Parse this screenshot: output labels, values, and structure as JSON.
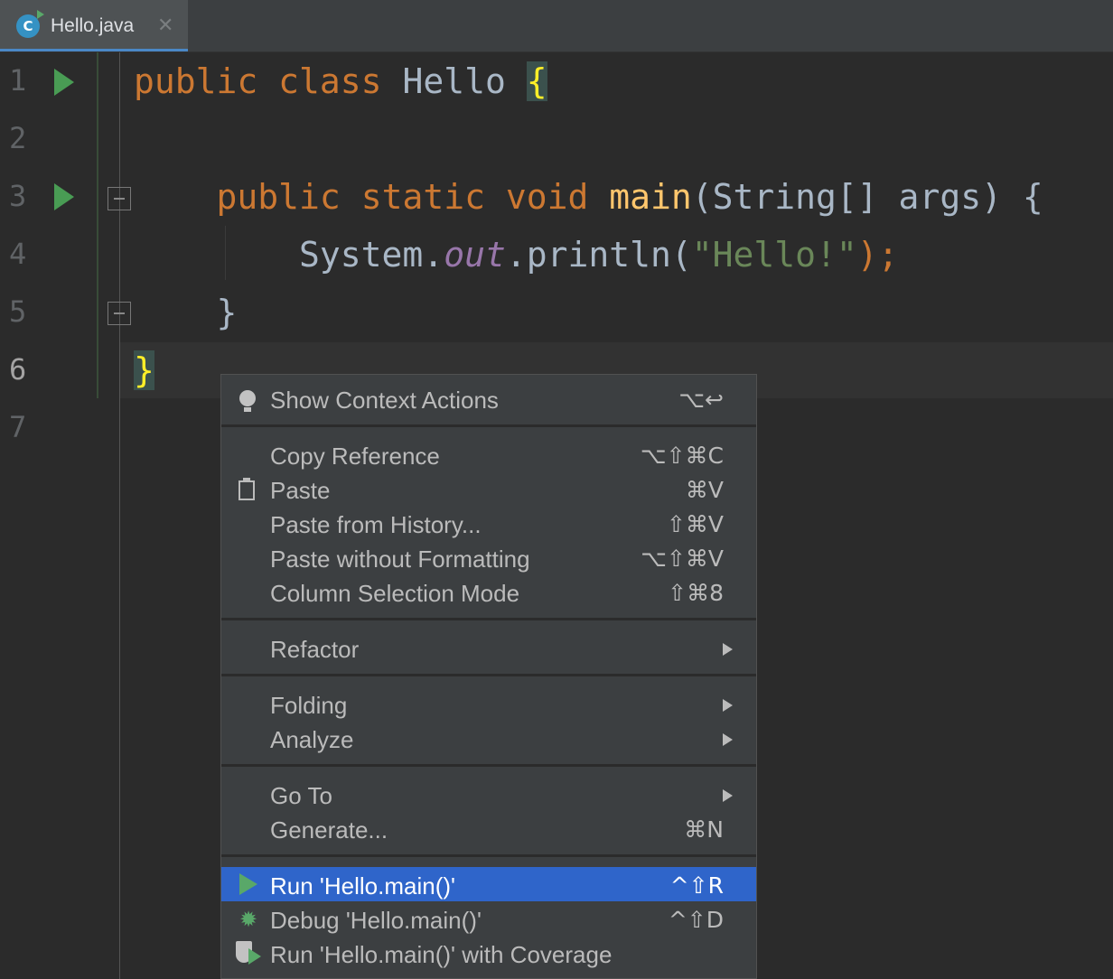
{
  "tab": {
    "title": "Hello.java",
    "icon": "class-icon",
    "icon_letter": "C"
  },
  "gutter": {
    "line_numbers": [
      "1",
      "2",
      "3",
      "4",
      "5",
      "6",
      "7"
    ]
  },
  "code": {
    "line1": {
      "kw1": "public",
      "kw2": "class",
      "name": "Hello",
      "brace": "{"
    },
    "line3": {
      "kw1": "public",
      "kw2": "static",
      "kw3": "void",
      "fn": "main",
      "params": "(String[] args) {"
    },
    "line4": {
      "obj": "System.",
      "field": "out",
      "call": ".println(",
      "str": "\"Hello!\"",
      "end": ");"
    },
    "line5": {
      "text": "}"
    },
    "line6": {
      "text": "}"
    }
  },
  "context_menu": {
    "show_context_actions": {
      "label": "Show Context Actions",
      "shortcut": "⌥↩"
    },
    "copy_reference": {
      "label": "Copy Reference",
      "shortcut": "⌥⇧⌘C"
    },
    "paste": {
      "label": "Paste",
      "shortcut": "⌘V"
    },
    "paste_from_history": {
      "label": "Paste from History...",
      "shortcut": "⇧⌘V"
    },
    "paste_without_formatting": {
      "label": "Paste without Formatting",
      "shortcut": "⌥⇧⌘V"
    },
    "column_selection_mode": {
      "label": "Column Selection Mode",
      "shortcut": "⇧⌘8"
    },
    "refactor": {
      "label": "Refactor"
    },
    "folding": {
      "label": "Folding"
    },
    "analyze": {
      "label": "Analyze"
    },
    "go_to": {
      "label": "Go To"
    },
    "generate": {
      "label": "Generate...",
      "shortcut": "⌘N"
    },
    "run": {
      "label": "Run 'Hello.main()'",
      "shortcut": "^⇧R"
    },
    "debug": {
      "label": "Debug 'Hello.main()'",
      "shortcut": "^⇧D"
    },
    "run_coverage": {
      "label": "Run 'Hello.main()' with Coverage"
    }
  },
  "colors": {
    "selection": "#2f65ca",
    "run_green": "#59a869",
    "keyword": "#cc7832",
    "function": "#ffc66d"
  }
}
